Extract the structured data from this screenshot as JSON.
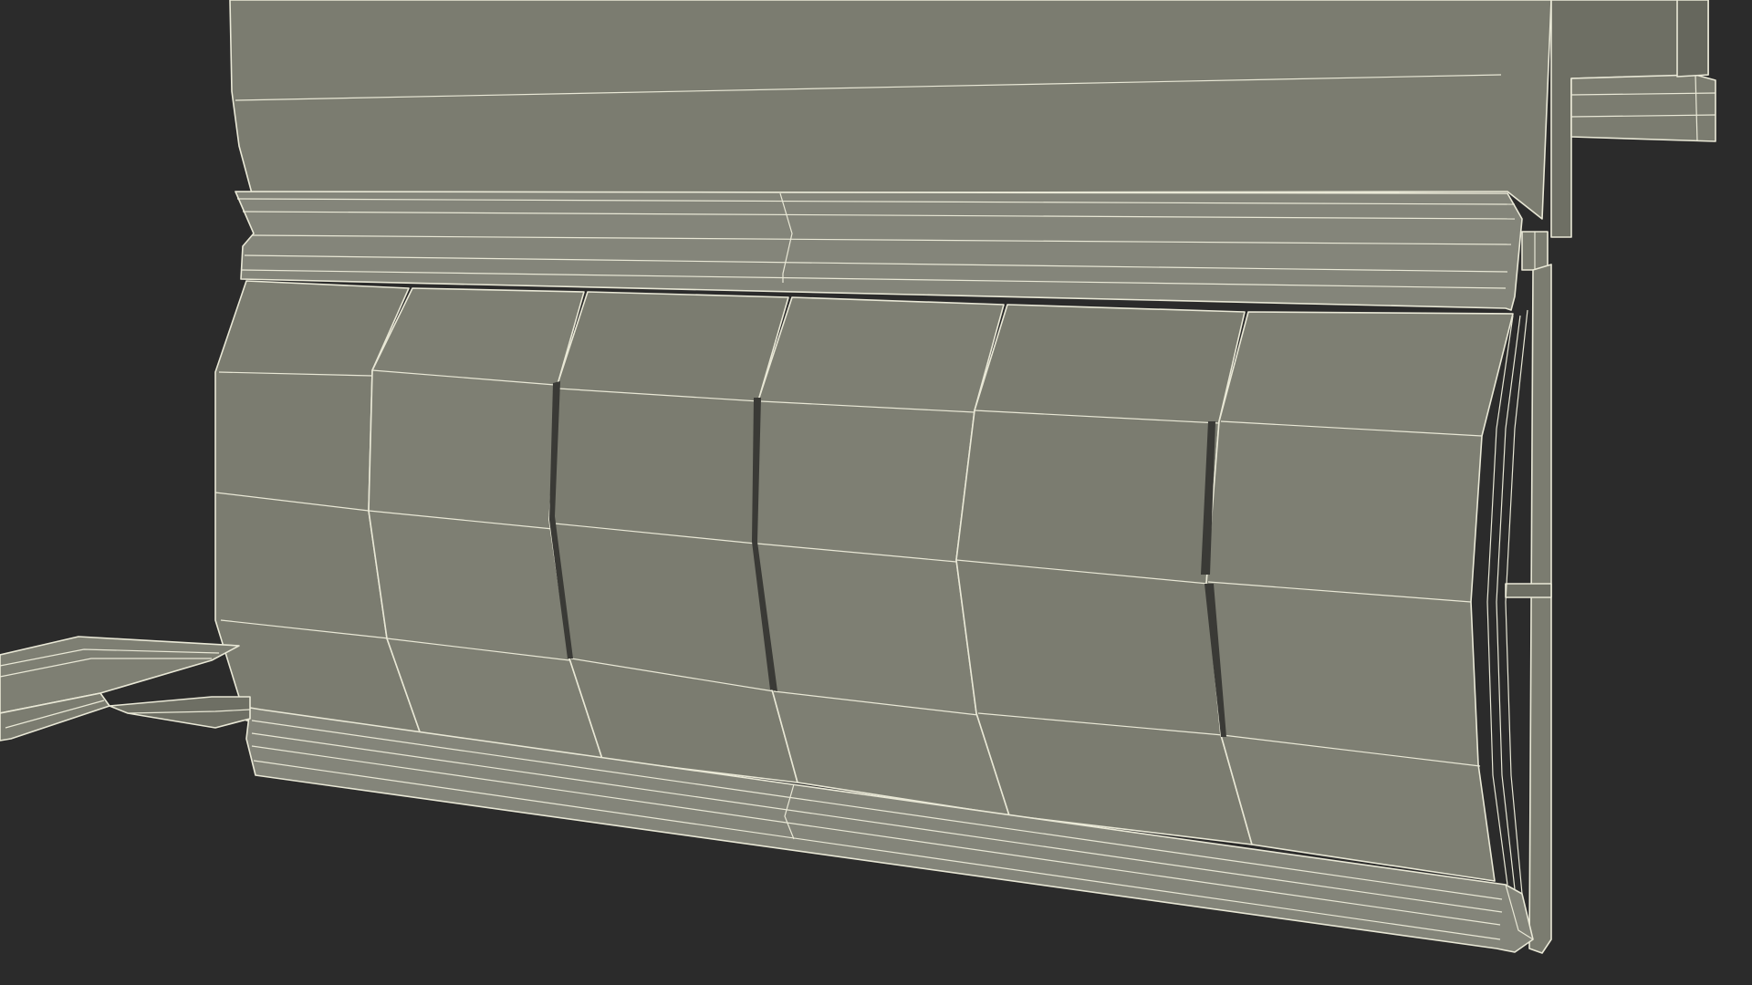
{
  "scene": {
    "background_color": "#2b2b2b",
    "mesh_fill_color": "#7b7c70",
    "mesh_shade_color": "#6e6f64",
    "mesh_light_color": "#85867a",
    "wire_color": "#e9e8d6",
    "gap_color": "#3a3a36",
    "object_description_icon": "3d-wireframe-blind-panel-icon",
    "visible_text": []
  }
}
